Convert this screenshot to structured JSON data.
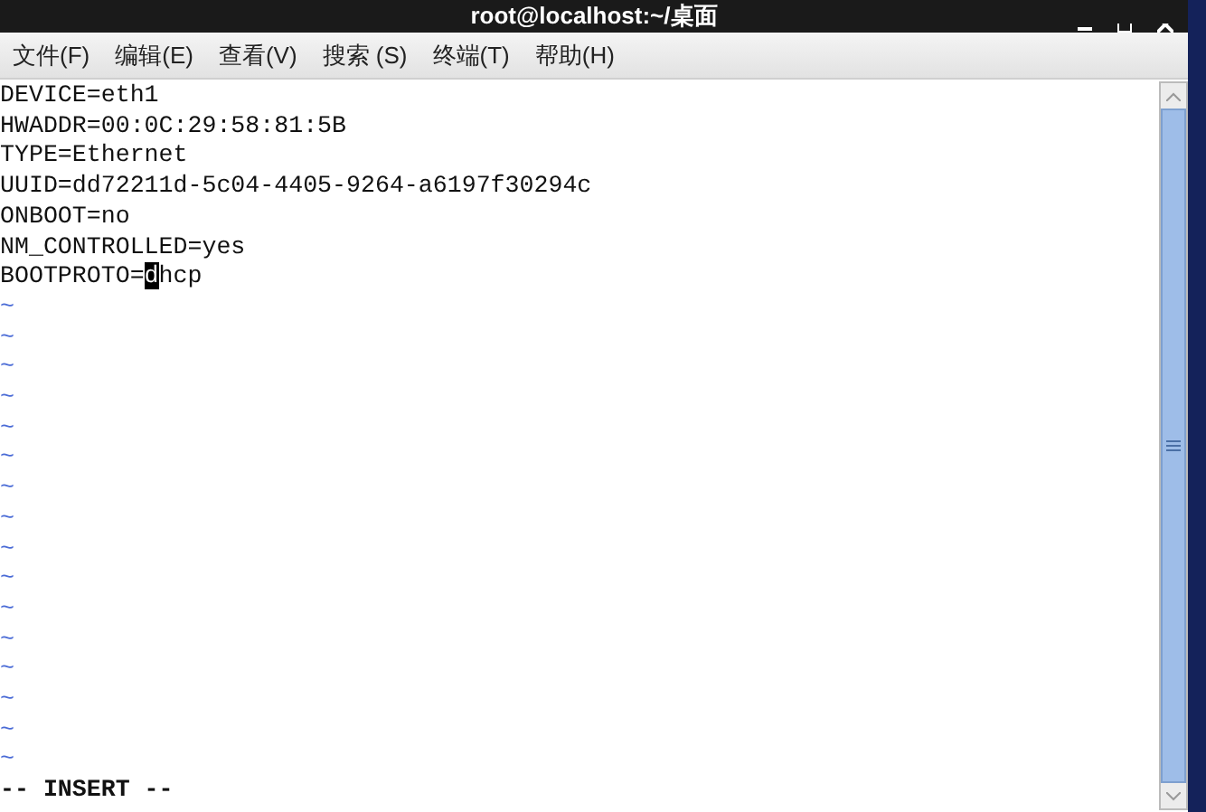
{
  "window": {
    "title": "root@localhost:~/桌面"
  },
  "menu": [
    "文件(F)",
    "编辑(E)",
    "查看(V)",
    "搜索 (S)",
    "终端(T)",
    "帮助(H)"
  ],
  "lines": [
    {
      "text": "DEVICE=eth1"
    },
    {
      "text": "HWADDR=00:0C:29:58:81:5B"
    },
    {
      "text": "TYPE=Ethernet"
    },
    {
      "text": "UUID=dd72211d-5c04-4405-9264-a6197f30294c"
    },
    {
      "text": "ONBOOT=no"
    },
    {
      "text": "NM_CONTROLLED=yes"
    },
    {
      "text": "BOOTPROTO=",
      "cursor_char": "d",
      "text_after_cursor": "hcp"
    }
  ],
  "empty_lines": [
    "~",
    "~",
    "~",
    "~",
    "~",
    "~",
    "~",
    "~",
    "~",
    "~",
    "~",
    "~",
    "~",
    "~",
    "~",
    "~"
  ],
  "status": "-- INSERT --"
}
